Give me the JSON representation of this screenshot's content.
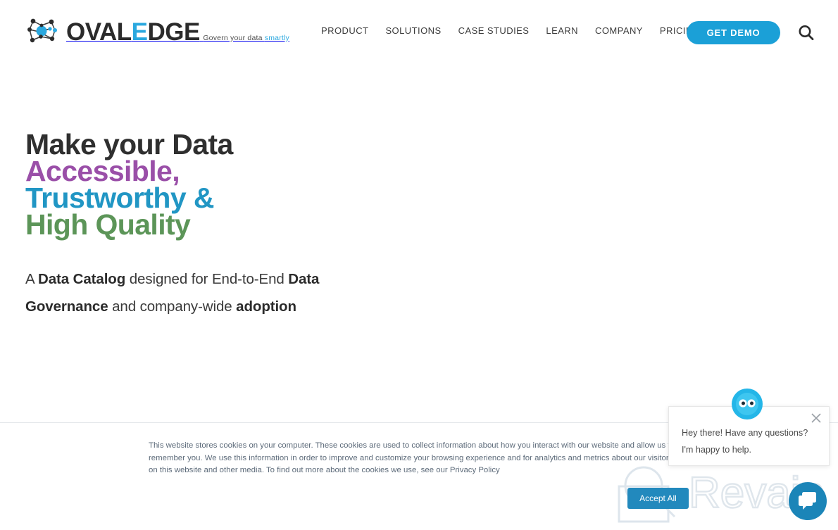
{
  "header": {
    "logo": {
      "icon": "network-nodes-icon",
      "word_oval": "OVAL",
      "word_e": "E",
      "word_dge": "DGE",
      "tagline_prefix": "Govern your data ",
      "tagline_accent": "smartly"
    },
    "nav": [
      {
        "label": "PRODUCT",
        "name": "nav-item-product"
      },
      {
        "label": "SOLUTIONS",
        "name": "nav-item-solutions"
      },
      {
        "label": "CASE STUDIES",
        "name": "nav-item-case-studies"
      },
      {
        "label": "LEARN",
        "name": "nav-item-learn"
      },
      {
        "label": "COMPANY",
        "name": "nav-item-company"
      },
      {
        "label": "PRICING",
        "name": "nav-item-pricing"
      }
    ],
    "demo_button": "GET DEMO",
    "search_icon": "search-icon",
    "accent_color": "#1ba0d7"
  },
  "hero": {
    "headline_line1": "Make your Data",
    "headline_line2": "Accessible,",
    "headline_line3": "Trustworthy &",
    "headline_line4": "High Quality",
    "headline_colors": {
      "line1": "#2f2f2f",
      "line2": "#9a4fa8",
      "line3": "#2196c4",
      "line4": "#5c9558"
    },
    "subhead": {
      "part1": "A ",
      "bold1": "Data Catalog",
      "part2": " designed for End-to-End ",
      "bold2": "Data Governance",
      "part3": " and company-wide ",
      "bold3": "adoption"
    }
  },
  "cookie_banner": {
    "text": "This website stores cookies on your computer. These cookies are used to collect information about how you interact with our website and allow us to remember you. We use this information in order to improve and customize your browsing experience and for analytics and metrics about our visitors on this website and other media. To find out more about the cookies we use, see our Privacy Policy",
    "accept_label": "Accept All",
    "accept_color": "#2289bd"
  },
  "chat_widget": {
    "message_line1": "Hey there! Have any questions?",
    "message_line2": "I'm happy to help.",
    "close_icon": "close-icon",
    "avatar_icon": "chat-avatar-icon",
    "launcher_icon": "chat-bubble-icon",
    "launcher_color": "#1b85b8"
  },
  "watermark": {
    "text": "Revain",
    "color": "#dfe6ec"
  }
}
